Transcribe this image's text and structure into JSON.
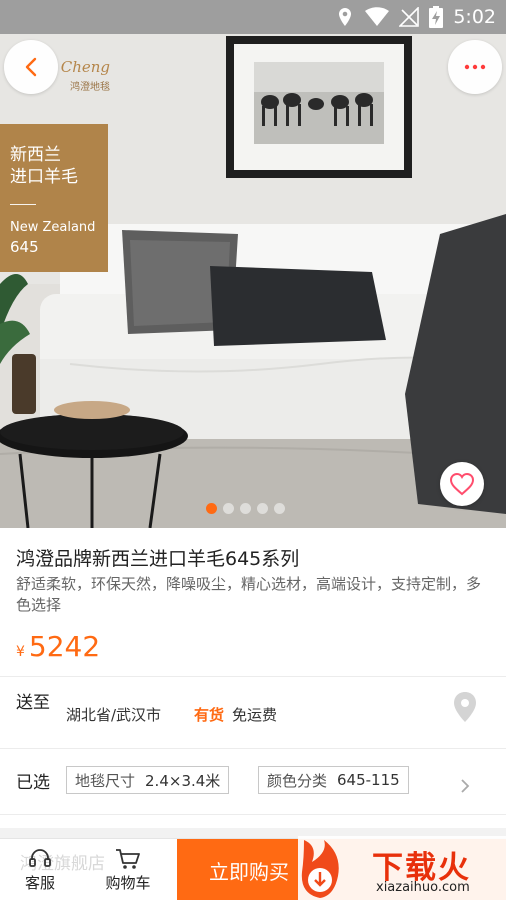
{
  "status_bar": {
    "time": "5:02"
  },
  "hero": {
    "brand_script": "Cheng",
    "brand_cn": "鸿澄地毯",
    "promo_line1": "新西兰",
    "promo_line2": "进口羊毛",
    "promo_line3": "New Zealand",
    "promo_line4": "645",
    "carousel_active_index": 0,
    "carousel_count": 5
  },
  "product": {
    "title": "鸿澄品牌新西兰进口羊毛645系列",
    "description": "舒适柔软，环保天然，降噪吸尘，精心选材，高端设计，支持定制，多色选择",
    "currency": "¥",
    "price": "5242"
  },
  "shipping": {
    "label": "送至",
    "location": "湖北省/武汉市",
    "stock": "有货",
    "fee": "免运费"
  },
  "selection": {
    "label": "已选",
    "options": [
      {
        "key": "地毯尺寸",
        "value": "2.4×3.4米"
      },
      {
        "key": "颜色分类",
        "value": "645-115"
      }
    ]
  },
  "bottom_bar": {
    "shop_ghost": "鸿澄旗舰店",
    "service_label": "客服",
    "cart_label": "购物车",
    "buy_label": "立即购买"
  },
  "watermark": {
    "text": "下载火",
    "url": "xiazaihuo.com"
  },
  "colors": {
    "accent": "#ff6a13",
    "promo_tag": "#b0844a",
    "status_bar": "#9e9e9e"
  }
}
